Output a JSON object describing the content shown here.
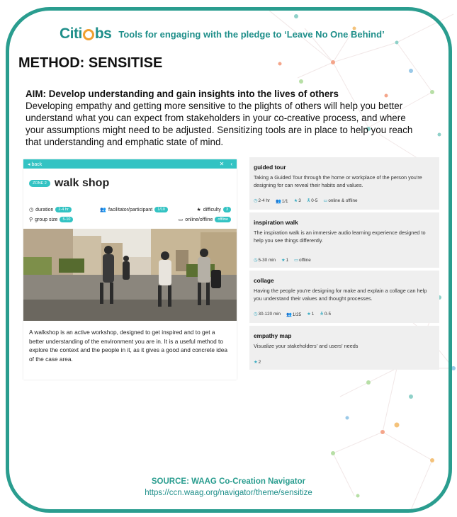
{
  "header": {
    "logo_text_left": "Citi",
    "logo_text_right": "bs",
    "tagline": "Tools for engaging with the pledge to ‘Leave No One Behind’"
  },
  "method_title": "METHOD: SENSITISE",
  "aim": {
    "heading": "AIM: Develop understanding and gain insights into the lives of others",
    "body": "Developing empathy and getting more sensitive to the plights of others will help you better understand what you can expect from stakeholders in your co-creative process, and where your assumptions might need to be adjusted. Sensitizing tools are in place to help you reach that understanding and emphatic state of mind."
  },
  "walkshop": {
    "back_label": "back",
    "zone": "ZONE 2",
    "title": "walk shop",
    "duration_label": "duration",
    "duration_value": "2-4 hr",
    "facilitator_label": "facilitator/participant",
    "facilitator_value": "1/10",
    "difficulty_label": "difficulty",
    "difficulty_value": "3",
    "group_label": "group size",
    "group_value": "5-10",
    "online_label": "online/offline",
    "online_value": "offline",
    "description": "A walkshop is an active workshop, designed to get inspired and to get a better understanding of the environment you are in. It is a useful method to explore the context and the people in it, as it gives a good and concrete idea of the case area."
  },
  "tools": [
    {
      "title": "guided tour",
      "desc": "Taking a Guided Tour through the home or workplace of the person you're designing for can reveal their habits and values.",
      "meta": [
        {
          "icon": "clock-icon",
          "glyph": "◷",
          "text": "2-4 hr"
        },
        {
          "icon": "people-icon",
          "glyph": "👥",
          "text": "1/1"
        },
        {
          "icon": "star-icon",
          "glyph": "★",
          "text": "3"
        },
        {
          "icon": "person-icon",
          "glyph": "🯅",
          "text": "0-5"
        },
        {
          "icon": "monitor-icon",
          "glyph": "▭",
          "text": "online & offline"
        }
      ]
    },
    {
      "title": "inspiration walk",
      "desc": "The inspiration walk is an immersive audio learning experience designed to help you see things differently.",
      "meta": [
        {
          "icon": "clock-icon",
          "glyph": "◷",
          "text": "5-30 min"
        },
        {
          "icon": "star-icon",
          "glyph": "★",
          "text": "1"
        },
        {
          "icon": "monitor-icon",
          "glyph": "▭",
          "text": "offline"
        }
      ]
    },
    {
      "title": "collage",
      "desc": "Having the people you're designing for make and explain a collage can help you understand their values and thought processes.",
      "meta": [
        {
          "icon": "clock-icon",
          "glyph": "◷",
          "text": "30-120 min"
        },
        {
          "icon": "people-icon",
          "glyph": "👥",
          "text": "1/25"
        },
        {
          "icon": "star-icon",
          "glyph": "★",
          "text": "1"
        },
        {
          "icon": "person-icon",
          "glyph": "🯅",
          "text": "0-5"
        }
      ]
    },
    {
      "title": "empathy map",
      "desc": "Visualize your stakeholders' and users' needs",
      "meta": [
        {
          "icon": "star-icon",
          "glyph": "★",
          "text": "2"
        }
      ]
    }
  ],
  "source": {
    "label": "SOURCE: WAAG Co-Creation Navigator",
    "url": "https://ccn.waag.org/navigator/theme/sensitize"
  },
  "colors": {
    "frame": "#2a9d8f",
    "accent": "#33c3c3",
    "logo_o": "#f0a030"
  }
}
